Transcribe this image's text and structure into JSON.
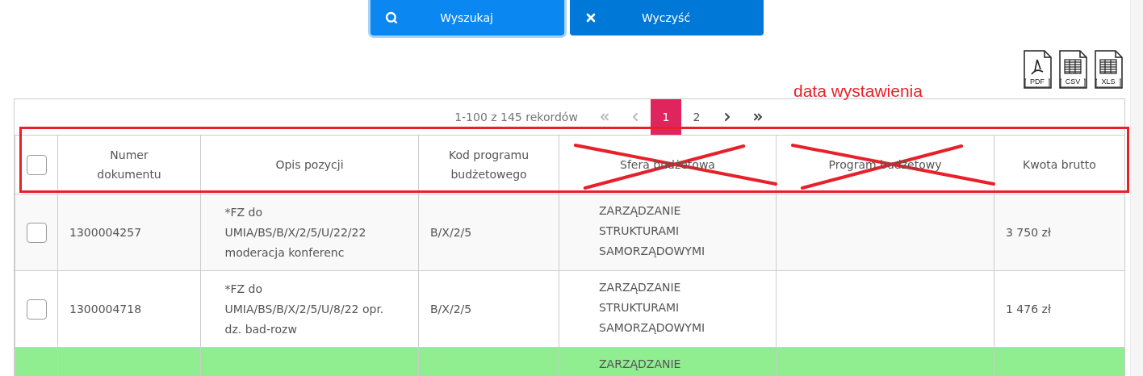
{
  "buttons": [
    {
      "kind": "search",
      "label": "Wyszukaj",
      "focused": true
    },
    {
      "kind": "clear",
      "label": "Wyczyść",
      "focused": false
    }
  ],
  "exports": [
    {
      "kind": "pdf",
      "label": "PDF"
    },
    {
      "kind": "csv",
      "label": "CSV"
    },
    {
      "kind": "xls",
      "label": "XLS"
    }
  ],
  "pagination": {
    "summary": "1-100 z 145 rekordów",
    "nav_before": [
      {
        "kind": "first",
        "disabled": true
      },
      {
        "kind": "prev",
        "disabled": true
      }
    ],
    "pages": [
      {
        "label": "1",
        "selected": true
      },
      {
        "label": "2",
        "selected": false
      }
    ],
    "nav_after": [
      {
        "kind": "next",
        "disabled": false
      },
      {
        "kind": "last",
        "disabled": false
      }
    ]
  },
  "annotation": {
    "label": "data wystawienia"
  },
  "table": {
    "select_all": {
      "checked": false
    },
    "columns": [
      {
        "label": "Numer dokumentu",
        "crossed_out": false
      },
      {
        "label": "Opis pozycji",
        "crossed_out": false
      },
      {
        "label": "Kod programu budżetowego",
        "crossed_out": false
      },
      {
        "label": "Sfera budżetowa",
        "crossed_out": true
      },
      {
        "label": "Program budżetowy",
        "crossed_out": true
      },
      {
        "label": "Kwota brutto",
        "crossed_out": false
      }
    ],
    "rows": [
      {
        "checked": false,
        "highlighted": false,
        "cells": [
          "1300004257",
          "*FZ do UMIA/BS/B/X/2/5/U/22/22 moderacja konferenc",
          "B/X/2/5",
          "ZARZĄDZANIE STRUKTURAMI SAMORZĄDOWYMI",
          null,
          "3 750 zł"
        ]
      },
      {
        "checked": false,
        "highlighted": false,
        "cells": [
          "1300004718",
          "*FZ do UMIA/BS/B/X/2/5/U/8/22 opr. dz. bad-rozw",
          "B/X/2/5",
          "ZARZĄDZANIE STRUKTURAMI SAMORZĄDOWYMI",
          null,
          "1 476 zł"
        ]
      },
      {
        "highlighted": true,
        "cells": [
          null,
          null,
          null,
          "ZARZĄDZANIE",
          null,
          null
        ]
      }
    ]
  }
}
